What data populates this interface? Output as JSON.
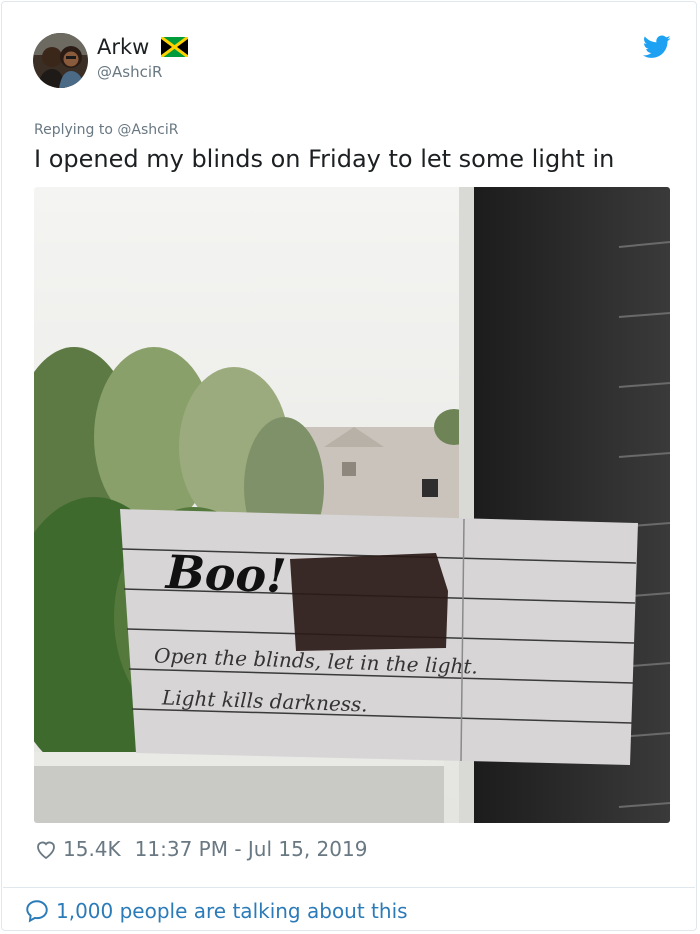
{
  "user": {
    "name": "Arkw",
    "handle": "@AshciR",
    "flag_icon": "jamaica-flag-icon",
    "avatar": "profile-photo"
  },
  "tweet": {
    "replying_to": "Replying to @AshciR",
    "text": "I opened my blinds on Friday to let some light in",
    "image": {
      "note_title": "Boo!",
      "note_line1": "Open the blinds, let in the light.",
      "note_line2": "Light kills darkness."
    },
    "likes": "15.4K",
    "timestamp": "11:37 PM - Jul 15, 2019",
    "talking": "1,000 people are talking about this"
  },
  "colors": {
    "link": "#2b7bb9",
    "twitter_blue": "#1da1f2",
    "muted": "#697882",
    "text": "#1c2022"
  },
  "icons": [
    "twitter-bird-icon",
    "heart-icon",
    "chat-bubble-icon",
    "jamaica-flag-icon"
  ]
}
